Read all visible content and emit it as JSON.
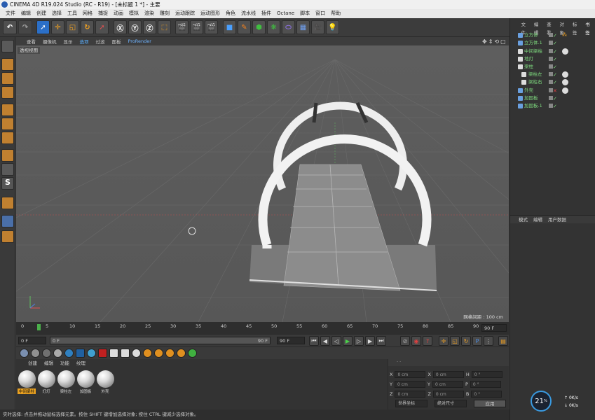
{
  "window": {
    "title": "CINEMA 4D R19.024 Studio (RC - R19) - [未标题 1 *] - 主要"
  },
  "menu": [
    "文件",
    "编辑",
    "创建",
    "选择",
    "工具",
    "网格",
    "捕捉",
    "动画",
    "模拟",
    "渲染",
    "雕刻",
    "运动跟踪",
    "运动图形",
    "角色",
    "流水线",
    "插件",
    "Octane",
    "脚本",
    "窗口",
    "帮助"
  ],
  "viewport_menu": [
    "查看",
    "摄像机",
    "显示",
    "选项",
    "过滤",
    "面板",
    "ProRender"
  ],
  "viewport": {
    "label": "透视视图",
    "grid_distance": "网格间距 : 100 cm"
  },
  "timeline": {
    "ticks": [
      "0",
      "5",
      "10",
      "15",
      "20",
      "25",
      "30",
      "35",
      "40",
      "45",
      "50",
      "55",
      "60",
      "65",
      "70",
      "75",
      "80",
      "85",
      "90"
    ],
    "end_field": "90 F"
  },
  "playback": {
    "current_frame": "0 F",
    "start": "0 F",
    "end_range": "90 F",
    "end_frame": "90 F"
  },
  "material_tabs": [
    "创建",
    "编辑",
    "功能",
    "纹理"
  ],
  "materials": [
    "中间梁柱",
    "灯灯",
    "梁柱左",
    "加固板",
    "外壳"
  ],
  "coords": {
    "rows": [
      {
        "a": "X",
        "v1": "0 cm",
        "b": "X",
        "v2": "0 cm",
        "c": "H",
        "v3": "0 °"
      },
      {
        "a": "Y",
        "v1": "0 cm",
        "b": "Y",
        "v2": "0 cm",
        "c": "P",
        "v3": "0 °"
      },
      {
        "a": "Z",
        "v1": "0 cm",
        "b": "Z",
        "v2": "0 cm",
        "c": "B",
        "v3": "0 °"
      }
    ],
    "mode1": "世界坐标",
    "mode2": "绝对尺寸",
    "apply": "应用"
  },
  "status": "实时选择: 点击并拖动鼠标选择元素。按住 SHIFT 键增加选择对象; 按住 CTRL 键减少选择对象。",
  "object_tabs": [
    "文件",
    "编辑",
    "查看",
    "对象",
    "标签",
    "书签"
  ],
  "objects": [
    {
      "name": "立方体",
      "color": "#6aa0e0"
    },
    {
      "name": "立方体.1",
      "color": "#6aa0e0"
    },
    {
      "name": "中间梁柱",
      "color": "#ddd"
    },
    {
      "name": "地灯",
      "color": "#ddd"
    },
    {
      "name": "梁柱",
      "color": "#ddd"
    },
    {
      "name": "梁柱左",
      "color": "#ddd"
    },
    {
      "name": "梁柱右",
      "color": "#ddd"
    },
    {
      "name": "外壳",
      "color": "#6aa0e0"
    },
    {
      "name": "加固板",
      "color": "#6aa0e0"
    },
    {
      "name": "加固板.1",
      "color": "#6aa0e0"
    }
  ],
  "attr_tabs": [
    "模式",
    "编辑",
    "用户数据"
  ],
  "perf": {
    "percent": "21",
    "up": "0K/s",
    "down": "0K/s"
  }
}
